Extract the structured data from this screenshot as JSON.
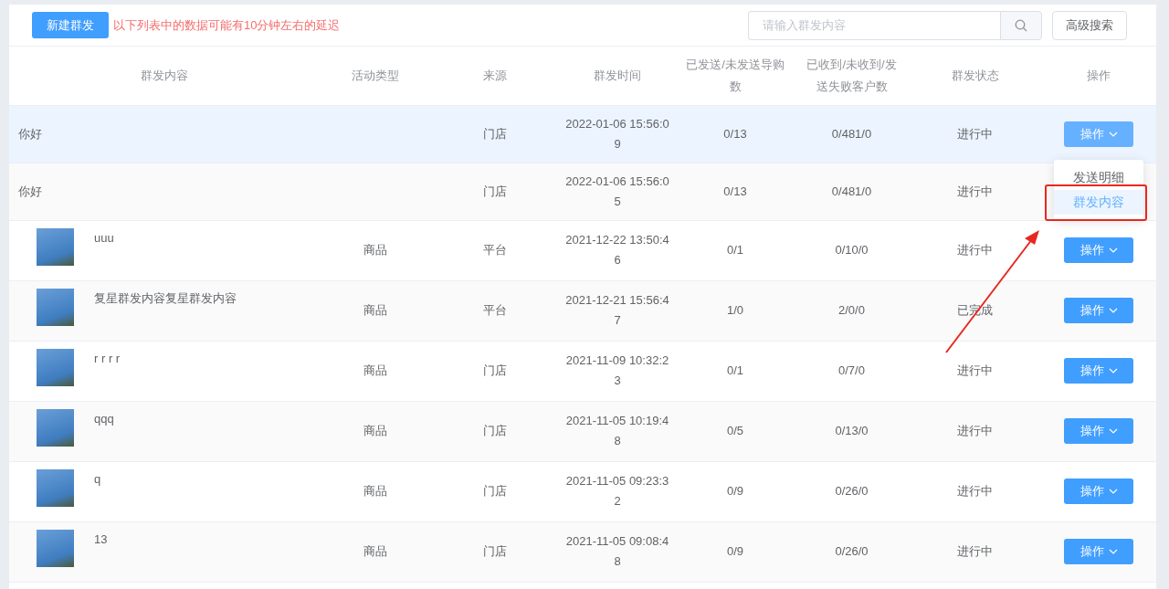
{
  "toolbar": {
    "new_button": "新建群发",
    "notice": "以下列表中的数据可能有10分钟左右的延迟",
    "search": {
      "placeholder": "请输入群发内容"
    },
    "advanced_button": "高级搜索"
  },
  "table": {
    "columns": [
      "群发内容",
      "活动类型",
      "来源",
      "群发时间",
      "已发送/未发送导购数",
      "已收到/未收到/发送失败客户数",
      "群发状态",
      "操作"
    ],
    "rows": [
      {
        "content": "你好",
        "has_thumbnail": false,
        "type": "",
        "source": "门店",
        "time": "2022-01-06 15:56:09",
        "sent": "0/13",
        "received": "0/481/0",
        "status": "进行中",
        "action": "操作",
        "highlighted": true,
        "menu": [
          {
            "label": "发送明细",
            "selected": false
          },
          {
            "label": "群发内容",
            "selected": true
          }
        ]
      },
      {
        "content": "你好",
        "has_thumbnail": false,
        "type": "",
        "source": "门店",
        "time": "2022-01-06 15:56:05",
        "sent": "0/13",
        "received": "0/481/0",
        "status": "进行中",
        "highlighted": false
      },
      {
        "content": "uuu",
        "has_thumbnail": true,
        "type": "商品",
        "source": "平台",
        "time": "2021-12-22 13:50:46",
        "sent": "0/1",
        "received": "0/10/0",
        "status": "进行中",
        "action": "操作",
        "highlighted": false
      },
      {
        "content": "复星群发内容复星群发内容",
        "has_thumbnail": true,
        "type": "商品",
        "source": "平台",
        "time": "2021-12-21 15:56:47",
        "sent": "1/0",
        "received": "2/0/0",
        "status": "已完成",
        "action": "操作",
        "highlighted": false
      },
      {
        "content": "r r r r",
        "has_thumbnail": true,
        "type": "商品",
        "source": "门店",
        "time": "2021-11-09 10:32:23",
        "sent": "0/1",
        "received": "0/7/0",
        "status": "进行中",
        "action": "操作",
        "highlighted": false
      },
      {
        "content": "qqq",
        "has_thumbnail": true,
        "type": "商品",
        "source": "门店",
        "time": "2021-11-05 10:19:48",
        "sent": "0/5",
        "received": "0/13/0",
        "status": "进行中",
        "action": "操作",
        "highlighted": false
      },
      {
        "content": "q",
        "has_thumbnail": true,
        "type": "商品",
        "source": "门店",
        "time": "2021-11-05 09:23:32",
        "sent": "0/9",
        "received": "0/26/0",
        "status": "进行中",
        "action": "操作",
        "highlighted": false
      },
      {
        "content": "13",
        "has_thumbnail": true,
        "type": "商品",
        "source": "门店",
        "time": "2021-11-05 09:08:48",
        "sent": "0/9",
        "received": "0/26/0",
        "status": "进行中",
        "action": "操作",
        "highlighted": false
      }
    ]
  },
  "annotation": {
    "box": true,
    "arrow": true
  }
}
